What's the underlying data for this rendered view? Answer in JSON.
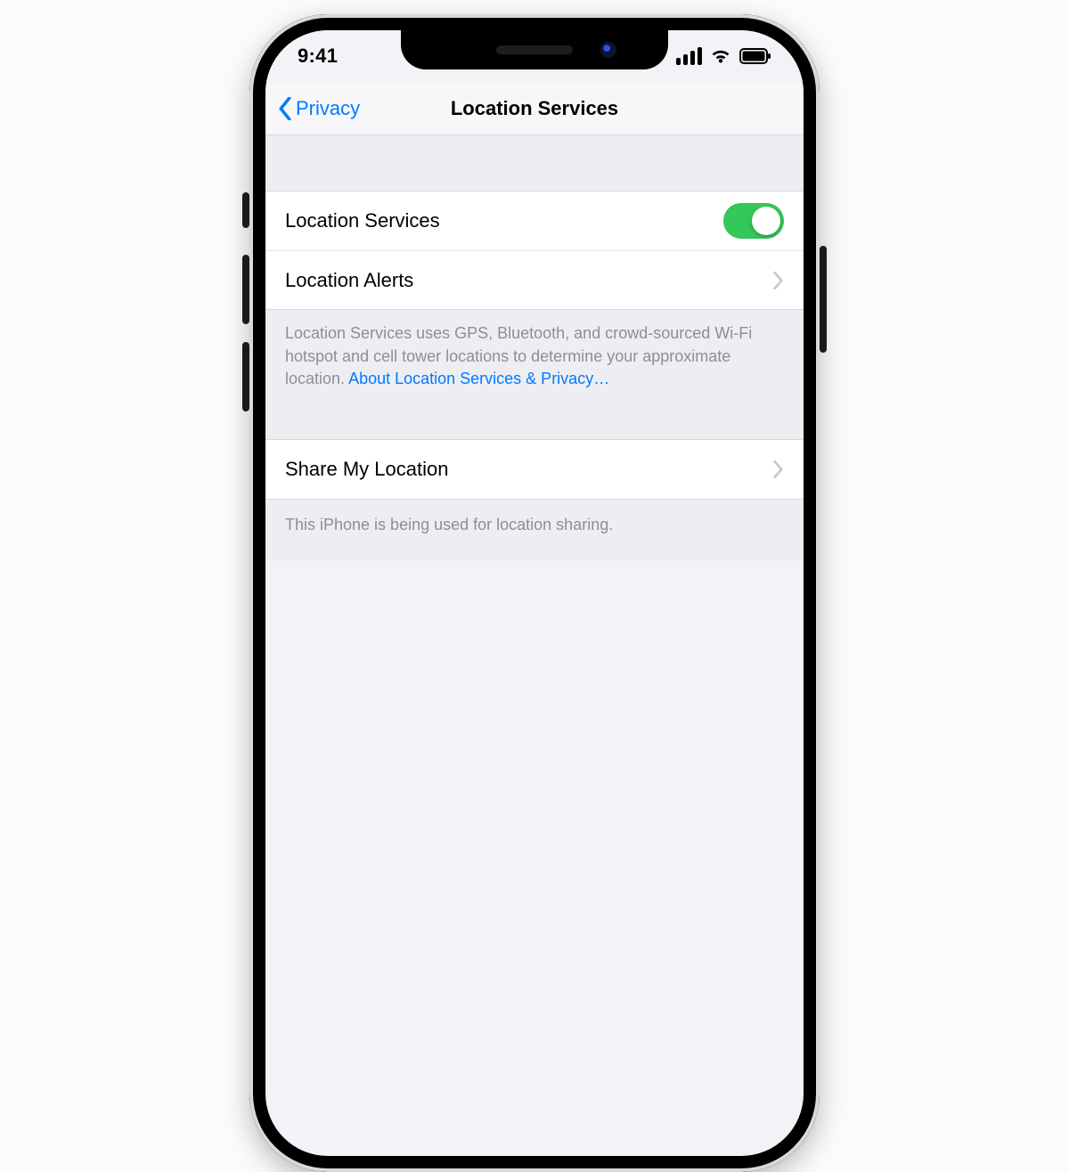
{
  "status": {
    "time": "9:41"
  },
  "nav": {
    "back": "Privacy",
    "title": "Location Services"
  },
  "section1": {
    "row1": {
      "label": "Location Services",
      "on": true
    },
    "row2": {
      "label": "Location Alerts"
    },
    "footer_text": "Location Services uses GPS, Bluetooth, and crowd-sourced Wi-Fi hotspot and cell tower locations to determine your approximate location. ",
    "footer_link": "About Location Services & Privacy…"
  },
  "section2": {
    "row1": {
      "label": "Share My Location"
    },
    "footer": "This iPhone is being used for location sharing."
  },
  "colors": {
    "tint": "#007aff",
    "toggle_on": "#34c759"
  }
}
